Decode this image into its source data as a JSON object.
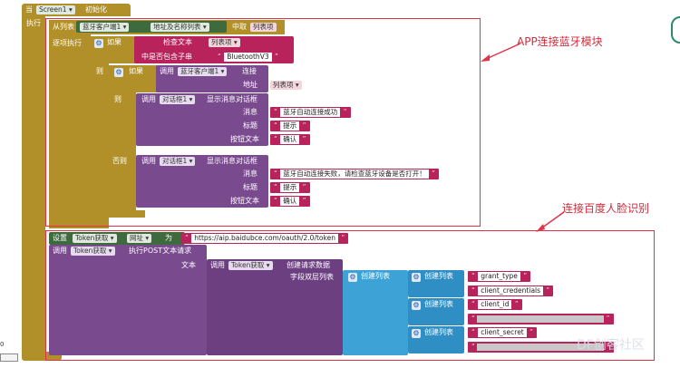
{
  "event": {
    "when": "当",
    "component": "Screen1",
    "event_name": "初始化",
    "do": "执行"
  },
  "foreach": {
    "from_list": "从列表",
    "list_component": "蓝牙客户端1",
    "list_prop": "地址及名称列表",
    "take": "中取",
    "var": "列表项",
    "each_do": "逐项执行"
  },
  "if1": {
    "if": "如果",
    "check_text": "检查文本",
    "var": "列表项",
    "contains": "中是否包含子串",
    "substring": "BluetoothV3",
    "then": "则"
  },
  "if2": {
    "if": "如果",
    "call": "调用",
    "component": "蓝牙客户端1",
    "method": "连接",
    "address_label": "地址",
    "var": "列表项",
    "then": "则",
    "else": "否则"
  },
  "notify_ok": {
    "call": "调用",
    "component": "对话框1",
    "method": "显示消息对话框",
    "msg_label": "消息",
    "msg": "蓝牙自动连接成功",
    "title_label": "标题",
    "title": "提示",
    "btn_label": "按钮文本",
    "btn": "确认"
  },
  "notify_fail": {
    "call": "调用",
    "component": "对话框1",
    "method": "显示消息对话框",
    "msg_label": "消息",
    "msg": "蓝牙自动连接失败，请检查蓝牙设备是否打开！",
    "title_label": "标题",
    "title": "提示",
    "btn_label": "按钮文本",
    "btn": "确认"
  },
  "set_url": {
    "set": "设置",
    "component": "Token获取",
    "prop": "网址",
    "to": "为",
    "url": "https://aip.baidubce.com/oauth/2.0/token"
  },
  "post": {
    "call": "调用",
    "component": "Token获取",
    "method": "执行POST文本请求",
    "text_label": "文本",
    "call2": "调用",
    "component2": "Token获取",
    "method2": "创建请求数据",
    "pairs_label": "字段双层列表",
    "create_list": "创建列表"
  },
  "pairs": [
    {
      "create": "创建列表",
      "key": "grant_type",
      "value": "client_credentials"
    },
    {
      "create": "创建列表",
      "key": "client_id",
      "value": ""
    },
    {
      "create": "创建列表",
      "key": "client_secret",
      "value": ""
    }
  ],
  "annotations": {
    "bluetooth": "APP连接蓝牙模块",
    "face": "连接百度人脸识别"
  },
  "watermark": "DF创客社区",
  "corner": {
    "zero": "0"
  }
}
